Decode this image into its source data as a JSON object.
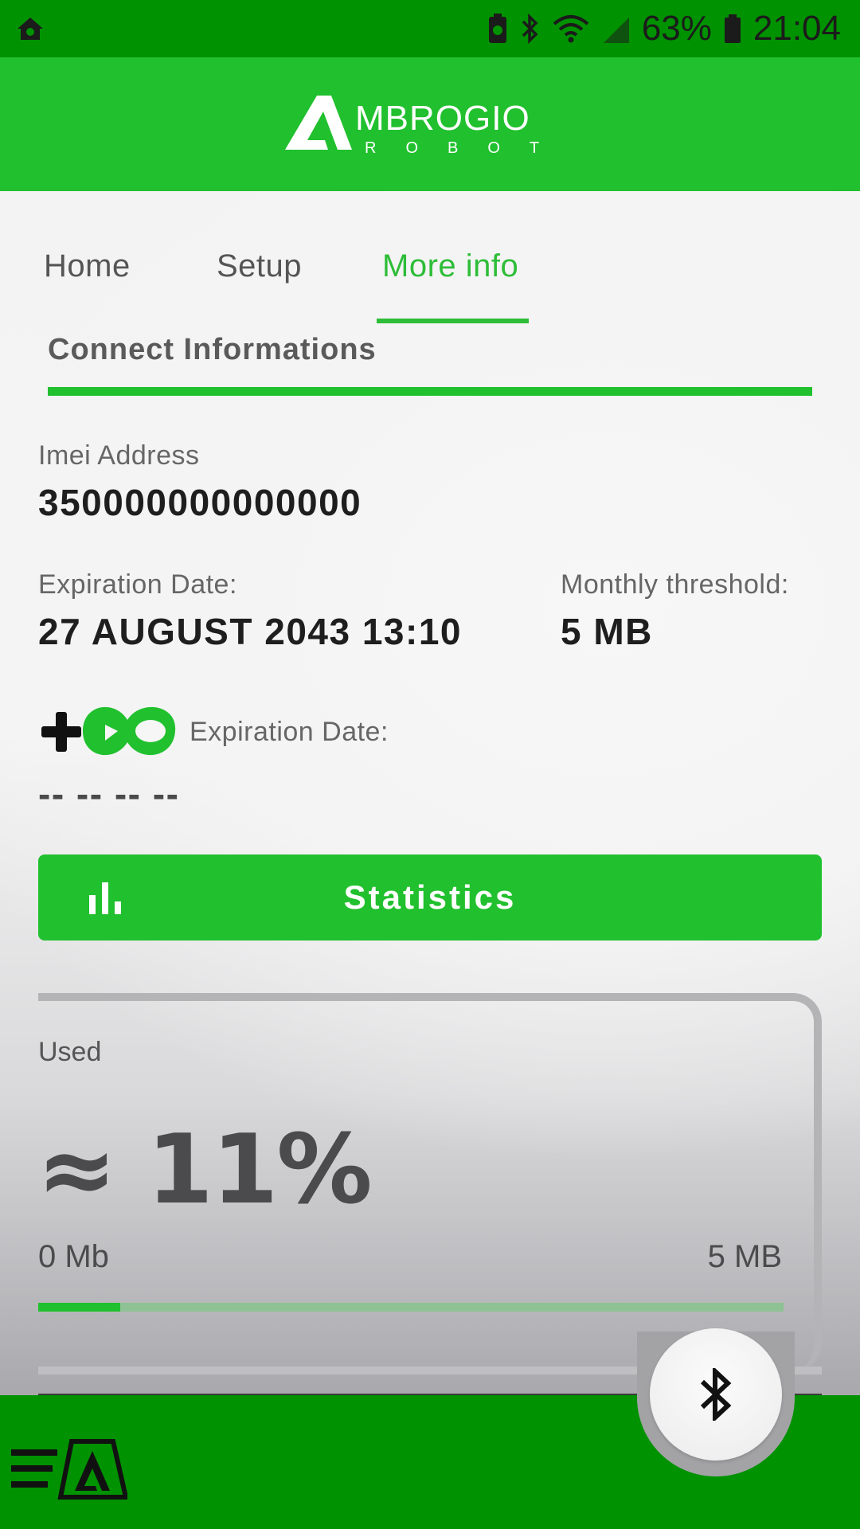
{
  "status_bar": {
    "battery_percent": "63%",
    "time": "21:04",
    "icons": [
      "home-shield-icon",
      "battery-saver-icon",
      "bluetooth-icon",
      "wifi-icon",
      "signal-icon",
      "battery-icon"
    ]
  },
  "header": {
    "logo_main": "AMBROGIO",
    "logo_sub": "ROBOT"
  },
  "tabs": [
    {
      "label": "Home",
      "active": false
    },
    {
      "label": "Setup",
      "active": false
    },
    {
      "label": "More info",
      "active": true
    }
  ],
  "section": {
    "title": "Connect Informations"
  },
  "imei": {
    "label": "Imei Address",
    "value": "350000000000000"
  },
  "expiration": {
    "label": "Expiration Date:",
    "value": "27 AUGUST 2043 13:10"
  },
  "threshold": {
    "label": "Monthly threshold:",
    "value": "5 MB"
  },
  "plus_plan": {
    "icon": "plus-infinity-icon",
    "label": "Expiration Date:",
    "value": "-- -- -- --"
  },
  "statistics_button": {
    "label": "Statistics",
    "icon": "bar-chart-icon"
  },
  "usage": {
    "label": "Used",
    "value": "≈ 11%",
    "fraction": 0.11,
    "min_label": "0 Mb",
    "max_label": "5 MB"
  },
  "bottom_bar": {
    "menu_icon": "menu-logo-icon",
    "fab_icon": "bluetooth-icon"
  },
  "colors": {
    "brand_green": "#21c02e",
    "dark_green": "#009200",
    "text_dark": "#1e1e1e"
  }
}
